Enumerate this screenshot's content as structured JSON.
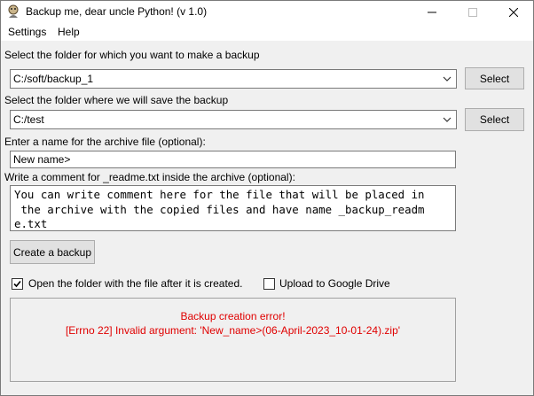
{
  "window": {
    "title": "Backup me, dear uncle Python! (v 1.0)",
    "minimize_glyph": "—",
    "maximize_glyph": "☐",
    "close_glyph": "✕"
  },
  "menu": {
    "items": [
      {
        "label": "Settings"
      },
      {
        "label": "Help"
      }
    ]
  },
  "source": {
    "label": "Select the folder for which you want to make a backup",
    "value": "C:/soft/backup_1",
    "button": "Select"
  },
  "destination": {
    "label": "Select the folder where we will save the backup",
    "value": "C:/test",
    "button": "Select"
  },
  "archive_name": {
    "label": "Enter a name for the archive file (optional):",
    "value": "New name>"
  },
  "comment": {
    "label": "Write a comment for _readme.txt inside the archive (optional):",
    "lines": [
      "You can write comment here for the file that will be placed in",
      " the archive with the copied files and have name _backup_readm",
      "e.txt"
    ]
  },
  "create_button": "Create a backup",
  "options": {
    "open_folder": {
      "label": "Open the folder with the file after it is created.",
      "checked": true
    },
    "upload_drive": {
      "label": "Upload to Google Drive",
      "checked": false
    }
  },
  "status": {
    "title": "Backup creation error!",
    "message": "[Errno 22] Invalid argument: 'New_name>(06-April-2023_10-01-24).zip'",
    "color": "#e00000"
  },
  "colors": {
    "window_bg": "#f0f0f0",
    "field_bg": "#ffffff",
    "button_bg": "#e1e1e1"
  },
  "icons": {
    "app": "python-logo-icon",
    "dropdown": "chevron-down-icon",
    "checkbox": "checkmark-icon"
  }
}
